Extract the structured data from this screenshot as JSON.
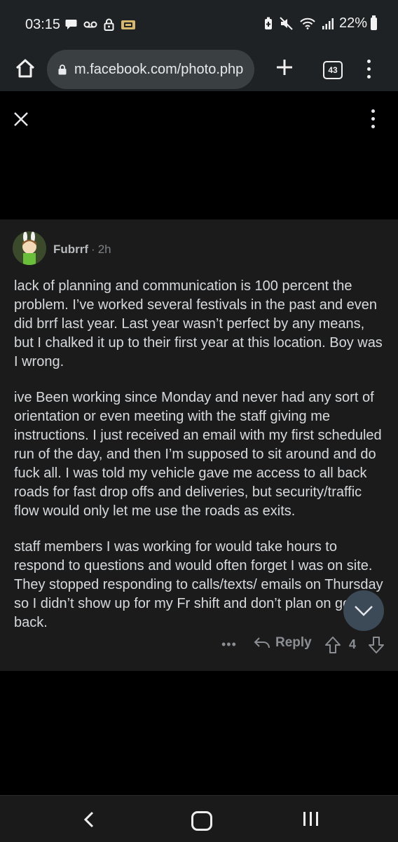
{
  "status_bar": {
    "time": "03:15",
    "battery": "22%",
    "left_icons": [
      "chat-bubble-icon",
      "voicemail-icon",
      "lock-icon",
      "ticket-icon"
    ],
    "right_icons": [
      "battery-saver-icon",
      "mute-icon",
      "wifi-icon",
      "signal-icon"
    ]
  },
  "browser": {
    "url": "m.facebook.com/photo.php",
    "tab_count": "43"
  },
  "comment": {
    "author": "Fubrrf",
    "separator": "·",
    "time": "2h",
    "paragraphs": [
      "lack of planning and communication is 100 percent the problem. I’ve worked several festivals in the past and even did brrf last year. Last year wasn’t perfect by any means, but I chalked it up to their first year at this location. Boy was I wrong.",
      "ive Been working since Monday and never had any sort of orientation or even meeting with the staff giving me instructions. I just received an email with my first scheduled run of the day, and then I’m supposed to sit around and do fuck all. I was told my vehicle gave me access to all back roads for fast drop offs and deliveries, but security/traffic flow would only let me use the roads as exits.",
      "staff members I was working for would take hours to respond to questions and would often forget I was on site. They stopped responding to calls/texts/ emails on Thursday so I didn’t show up for my Fr shift and don’t plan on going back."
    ],
    "more": "•••",
    "reply_label": "Reply",
    "votes": "4"
  },
  "colors": {
    "background": "#000000",
    "card": "#1b1b1c",
    "text": "#d7dadc",
    "muted": "#8b8e92"
  }
}
